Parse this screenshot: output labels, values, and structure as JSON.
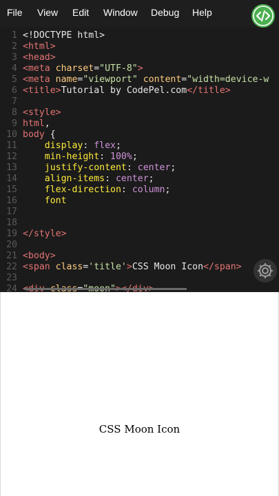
{
  "menu": {
    "items": [
      {
        "label": "File"
      },
      {
        "label": "View"
      },
      {
        "label": "Edit"
      },
      {
        "label": "Window"
      },
      {
        "label": "Debug"
      },
      {
        "label": "Help"
      }
    ],
    "run_icon": "code-run-icon"
  },
  "editor": {
    "lines": [
      {
        "n": "1",
        "parts": [
          {
            "t": "<!DOCTYPE html>",
            "c": "punc"
          }
        ]
      },
      {
        "n": "2",
        "parts": [
          {
            "t": "<html>",
            "c": "tag"
          }
        ]
      },
      {
        "n": "3",
        "parts": [
          {
            "t": "<head>",
            "c": "tag"
          }
        ]
      },
      {
        "n": "4",
        "parts": [
          {
            "t": "<meta ",
            "c": "tag"
          },
          {
            "t": "charset",
            "c": "attr"
          },
          {
            "t": "=",
            "c": "punc"
          },
          {
            "t": "\"UTF-8\"",
            "c": "str"
          },
          {
            "t": ">",
            "c": "tag"
          }
        ]
      },
      {
        "n": "5",
        "parts": [
          {
            "t": "<meta ",
            "c": "tag"
          },
          {
            "t": "name",
            "c": "attr"
          },
          {
            "t": "=",
            "c": "punc"
          },
          {
            "t": "\"viewport\" ",
            "c": "str"
          },
          {
            "t": "content",
            "c": "attr"
          },
          {
            "t": "=",
            "c": "punc"
          },
          {
            "t": "\"width=device-w",
            "c": "str"
          }
        ]
      },
      {
        "n": "6",
        "parts": [
          {
            "t": "<title>",
            "c": "tag"
          },
          {
            "t": "Tutorial by CodePel.com",
            "c": "punc"
          },
          {
            "t": "</title>",
            "c": "tag"
          }
        ]
      },
      {
        "n": "7",
        "parts": []
      },
      {
        "n": "8",
        "parts": [
          {
            "t": "<style>",
            "c": "tag"
          }
        ]
      },
      {
        "n": "9",
        "parts": [
          {
            "t": "html",
            "c": "tag"
          },
          {
            "t": ",",
            "c": "punc"
          }
        ]
      },
      {
        "n": "10",
        "parts": [
          {
            "t": "body",
            "c": "tag"
          },
          {
            "t": " {",
            "c": "punc"
          }
        ]
      },
      {
        "n": "11",
        "parts": [
          {
            "t": "    display",
            "c": "prop"
          },
          {
            "t": ": ",
            "c": "punc"
          },
          {
            "t": "flex",
            "c": "val"
          },
          {
            "t": ";",
            "c": "punc"
          }
        ]
      },
      {
        "n": "12",
        "parts": [
          {
            "t": "    min-height",
            "c": "prop"
          },
          {
            "t": ": ",
            "c": "punc"
          },
          {
            "t": "100%",
            "c": "val"
          },
          {
            "t": ";",
            "c": "punc"
          }
        ]
      },
      {
        "n": "13",
        "parts": [
          {
            "t": "    justify-content",
            "c": "prop"
          },
          {
            "t": ": ",
            "c": "punc"
          },
          {
            "t": "center",
            "c": "val"
          },
          {
            "t": ";",
            "c": "punc"
          }
        ]
      },
      {
        "n": "14",
        "parts": [
          {
            "t": "    align-items",
            "c": "prop"
          },
          {
            "t": ": ",
            "c": "punc"
          },
          {
            "t": "center",
            "c": "val"
          },
          {
            "t": ";",
            "c": "punc"
          }
        ]
      },
      {
        "n": "15",
        "parts": [
          {
            "t": "    flex-direction",
            "c": "prop"
          },
          {
            "t": ": ",
            "c": "punc"
          },
          {
            "t": "column",
            "c": "val"
          },
          {
            "t": ";",
            "c": "punc"
          }
        ]
      },
      {
        "n": "16",
        "parts": [
          {
            "t": "    font",
            "c": "prop"
          }
        ]
      },
      {
        "n": "17",
        "parts": []
      },
      {
        "n": "18",
        "parts": []
      },
      {
        "n": "19",
        "parts": [
          {
            "t": "</style>",
            "c": "tag"
          }
        ]
      },
      {
        "n": "20",
        "parts": []
      },
      {
        "n": "21",
        "parts": [
          {
            "t": "<body>",
            "c": "tag"
          }
        ]
      },
      {
        "n": "22",
        "parts": [
          {
            "t": "<span ",
            "c": "tag"
          },
          {
            "t": "class",
            "c": "attr"
          },
          {
            "t": "=",
            "c": "punc"
          },
          {
            "t": "'title'",
            "c": "str"
          },
          {
            "t": ">",
            "c": "tag"
          },
          {
            "t": "CSS Moon Icon",
            "c": "punc"
          },
          {
            "t": "</span>",
            "c": "tag"
          }
        ]
      },
      {
        "n": "23",
        "parts": []
      },
      {
        "n": "24",
        "parts": [
          {
            "t": "<div ",
            "c": "tag"
          },
          {
            "t": "class",
            "c": "attr"
          },
          {
            "t": "=",
            "c": "punc"
          },
          {
            "t": "\"moon\"",
            "c": "str"
          },
          {
            "t": "></div>",
            "c": "tag"
          }
        ]
      }
    ],
    "settings_icon": "gear-icon"
  },
  "preview": {
    "title": "CSS Moon Icon"
  },
  "colors": {
    "menubar": "#1e1e1e",
    "editor_bg": "#1b1b1b",
    "tag": "#e57373",
    "attr": "#ffcc80",
    "string": "#c5e1a5",
    "property": "#ffeb3b",
    "value": "#ce93d8",
    "run_button": "#4caf50"
  }
}
